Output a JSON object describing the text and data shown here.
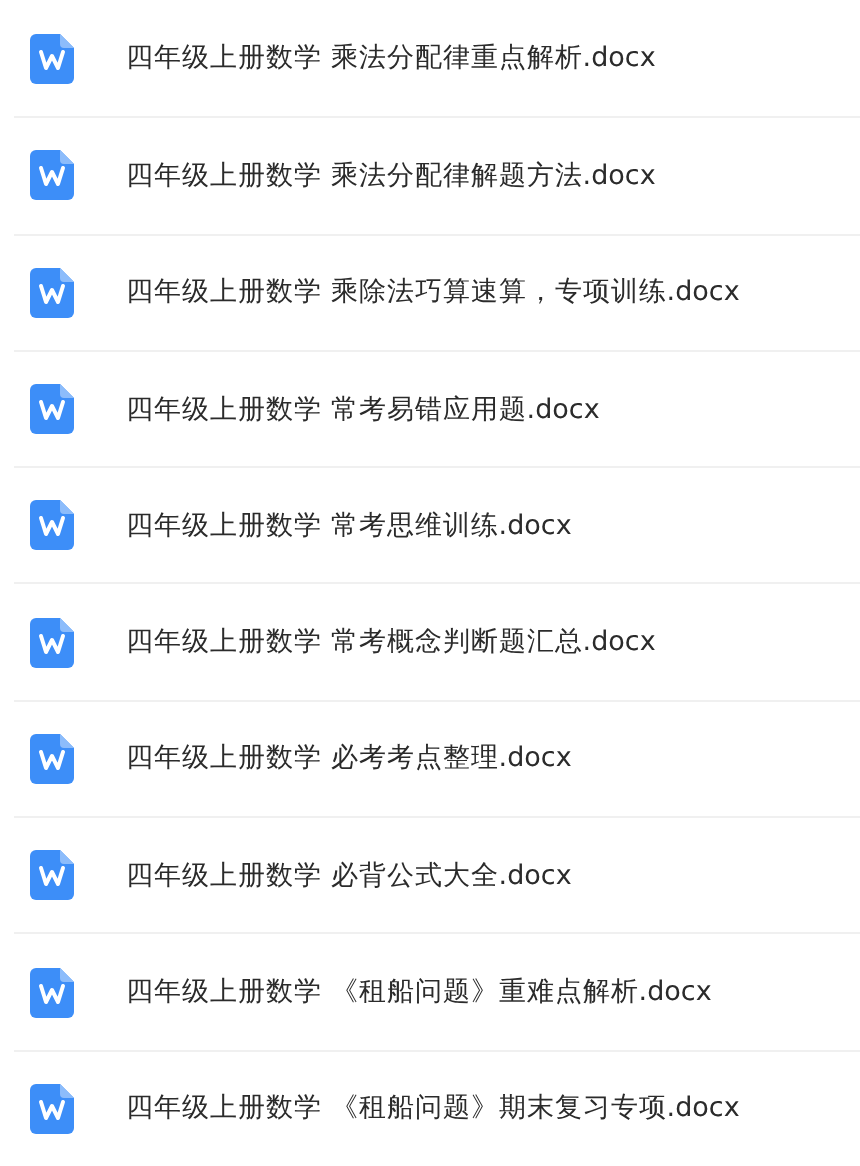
{
  "files": [
    {
      "name": "四年级上册数学 乘法分配律重点解析.docx"
    },
    {
      "name": "四年级上册数学 乘法分配律解题方法.docx"
    },
    {
      "name": "四年级上册数学 乘除法巧算速算，专项训练.docx"
    },
    {
      "name": "四年级上册数学 常考易错应用题.docx"
    },
    {
      "name": "四年级上册数学 常考思维训练.docx"
    },
    {
      "name": "四年级上册数学 常考概念判断题汇总.docx"
    },
    {
      "name": "四年级上册数学 必考考点整理.docx"
    },
    {
      "name": "四年级上册数学 必背公式大全.docx"
    },
    {
      "name": "四年级上册数学 《租船问题》重难点解析.docx"
    },
    {
      "name": "四年级上册数学 《租船问题》期末复习专项.docx"
    }
  ]
}
